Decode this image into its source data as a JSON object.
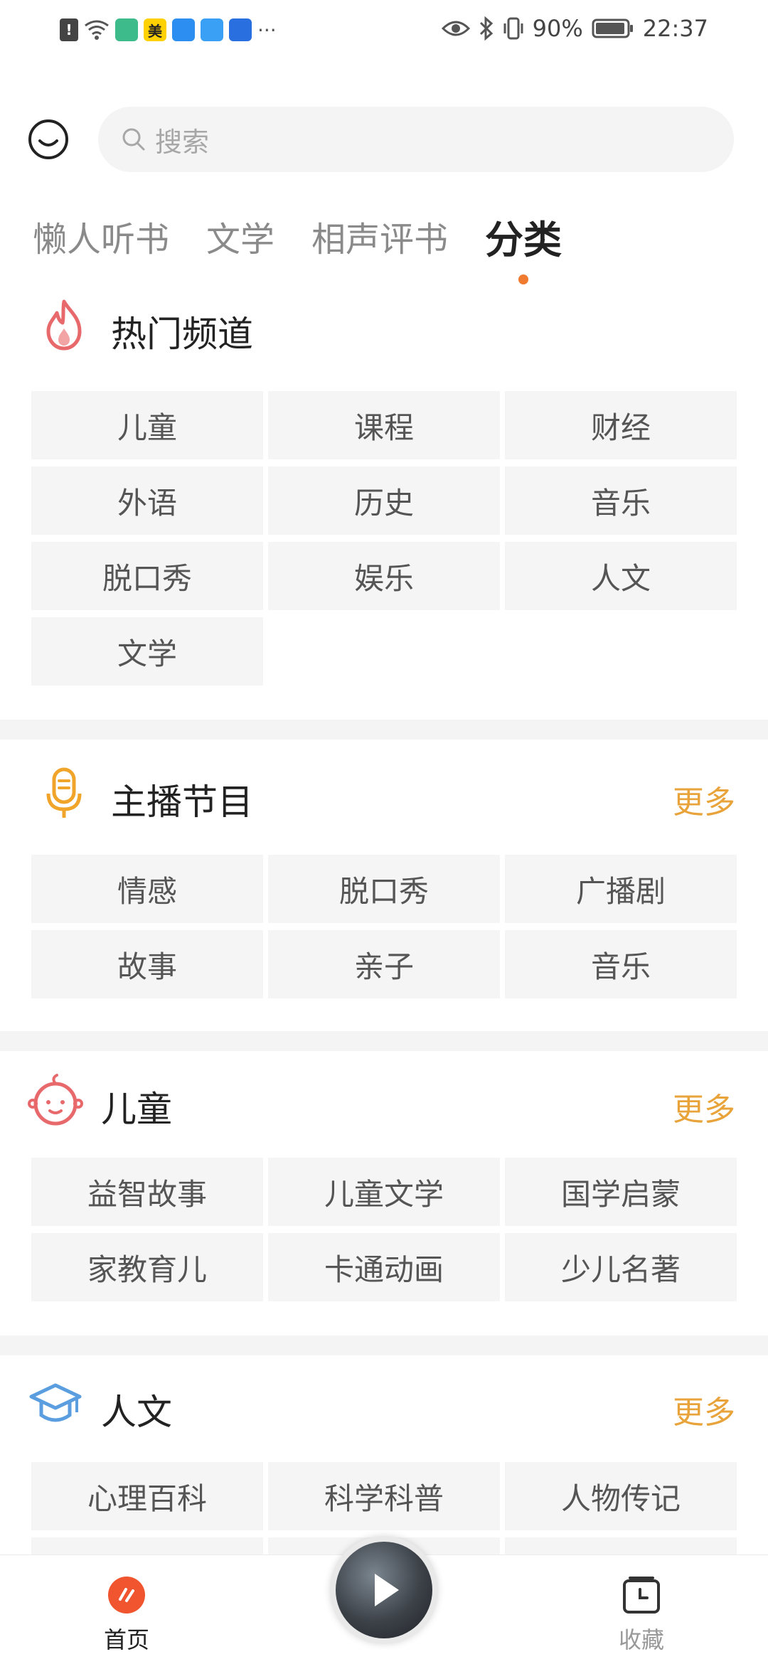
{
  "status_bar": {
    "battery": "90%",
    "time": "22:37",
    "more_dots": "···",
    "app_badge_text": "美"
  },
  "search": {
    "placeholder": "搜索"
  },
  "tabs": [
    {
      "label": "懒人听书",
      "active": false
    },
    {
      "label": "文学",
      "active": false
    },
    {
      "label": "相声评书",
      "active": false
    },
    {
      "label": "分类",
      "active": true
    }
  ],
  "sections": {
    "hot": {
      "title": "热门频道",
      "items": [
        "儿童",
        "课程",
        "财经",
        "外语",
        "历史",
        "音乐",
        "脱口秀",
        "娱乐",
        "人文",
        "文学"
      ]
    },
    "anchor": {
      "title": "主播节目",
      "more": "更多",
      "items": [
        "情感",
        "脱口秀",
        "广播剧",
        "故事",
        "亲子",
        "音乐"
      ]
    },
    "kids": {
      "title": "儿童",
      "more": "更多",
      "items": [
        "益智故事",
        "儿童文学",
        "国学启蒙",
        "家教育儿",
        "卡通动画",
        "少儿名著"
      ]
    },
    "humanities": {
      "title": "人文",
      "more": "更多",
      "items": [
        "心理百科",
        "科学科普",
        "人物传记"
      ]
    }
  },
  "bottom_nav": {
    "home_label": "首页",
    "favorites_label": "收藏"
  },
  "colors": {
    "accent": "#f07a2f",
    "more": "#e8a33a",
    "hot_icon": "#e8696b",
    "mic_icon": "#f0a52a",
    "kids_icon": "#e8696b",
    "edu_icon": "#5b9ee0"
  }
}
